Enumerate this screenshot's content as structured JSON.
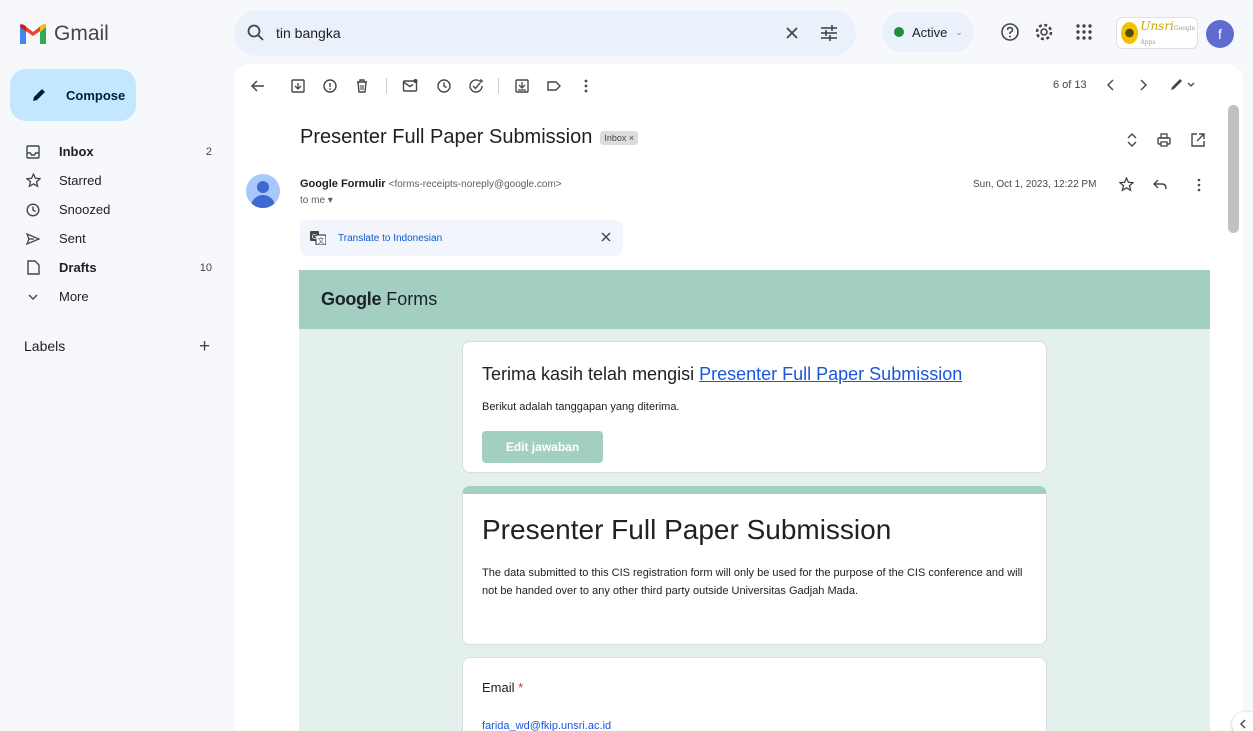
{
  "app": {
    "name": "Gmail"
  },
  "search": {
    "query": "tin bangka"
  },
  "status": {
    "label": "Active"
  },
  "account": {
    "initial": "f",
    "org_logo": "Unsri",
    "org_logo_sub": "Google Apps"
  },
  "sidebar": {
    "compose_label": "Compose",
    "items": [
      {
        "label": "Inbox",
        "count": "2",
        "icon": "inbox-icon"
      },
      {
        "label": "Starred",
        "count": "",
        "icon": "star-icon"
      },
      {
        "label": "Snoozed",
        "count": "",
        "icon": "clock-icon"
      },
      {
        "label": "Sent",
        "count": "",
        "icon": "send-icon"
      },
      {
        "label": "Drafts",
        "count": "10",
        "icon": "draft-icon"
      },
      {
        "label": "More",
        "count": "",
        "icon": "chevron-down-icon"
      }
    ],
    "labels_title": "Labels",
    "labels_add": "+"
  },
  "toolbar": {
    "pager": "6 of 13"
  },
  "email": {
    "subject": "Presenter Full Paper Submission",
    "tag": "Inbox ×",
    "sender_name": "Google Formulir",
    "sender_addr": "<forms-receipts-noreply@google.com>",
    "to": "to me ▾",
    "date": "Sun, Oct 1, 2023, 12:22 PM",
    "translate": "Translate to Indonesian"
  },
  "form": {
    "brand_strong": "Google",
    "brand_rest": " Forms",
    "thanks_prefix": "Terima kasih telah mengisi ",
    "thanks_link": "Presenter Full Paper Submission",
    "received": "Berikut adalah tanggapan yang diterima.",
    "edit_button": "Edit jawaban",
    "title": "Presenter Full Paper Submission",
    "description": "The data submitted to this CIS registration form will only be used for the purpose of the CIS conference and will not be handed over to any other third party outside Universitas Gadjah Mada.",
    "email_label": "Email",
    "email_required": "*",
    "email_value": "farida_wd@fkip.unsri.ac.id"
  },
  "colors": {
    "accent": "#a3cfc3",
    "compose": "#c2e7ff",
    "background": "#f6f8fc"
  }
}
